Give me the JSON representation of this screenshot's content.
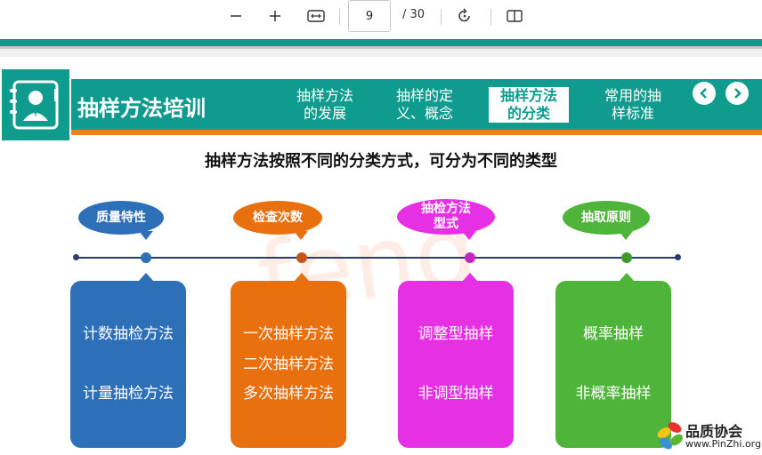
{
  "toolbar": {
    "zoom_out_icon": "minus-icon",
    "zoom_in_icon": "plus-icon",
    "fit_icon": "fit-width-icon",
    "current_page": "9",
    "total_pages": "/ 30",
    "rotate_icon": "rotate-icon",
    "view_icon": "page-view-icon"
  },
  "slide": {
    "title": "抽样方法培训",
    "nav": [
      {
        "line1": "抽样方法",
        "line2": "的发展"
      },
      {
        "line1": "抽样的定",
        "line2": "义、概念"
      },
      {
        "line1": "抽样方法",
        "line2": "的分类",
        "active": true
      },
      {
        "line1": "常用的抽",
        "line2": "样标准"
      }
    ],
    "heading": "抽样方法按照不同的分类方式，可分为不同的类型",
    "watermark": "feng",
    "categories": [
      {
        "label": "质量特性",
        "color": "#2e70b8",
        "items": [
          "计数抽检方法",
          "计量抽检方法"
        ]
      },
      {
        "label": "检查次数",
        "color": "#e8700f",
        "items": [
          "一次抽样方法",
          "二次抽样方法",
          "多次抽样方法"
        ]
      },
      {
        "label1": "抽检方法",
        "label2": "型式",
        "color": "#e530e3",
        "items": [
          "调整型抽样",
          "非调型抽样"
        ]
      },
      {
        "label": "抽取原则",
        "color": "#4fb43a",
        "items": [
          "概率抽样",
          "非概率抽样"
        ]
      }
    ],
    "brand": {
      "name": "品质协会",
      "url": "www.PinZhi.org"
    }
  }
}
